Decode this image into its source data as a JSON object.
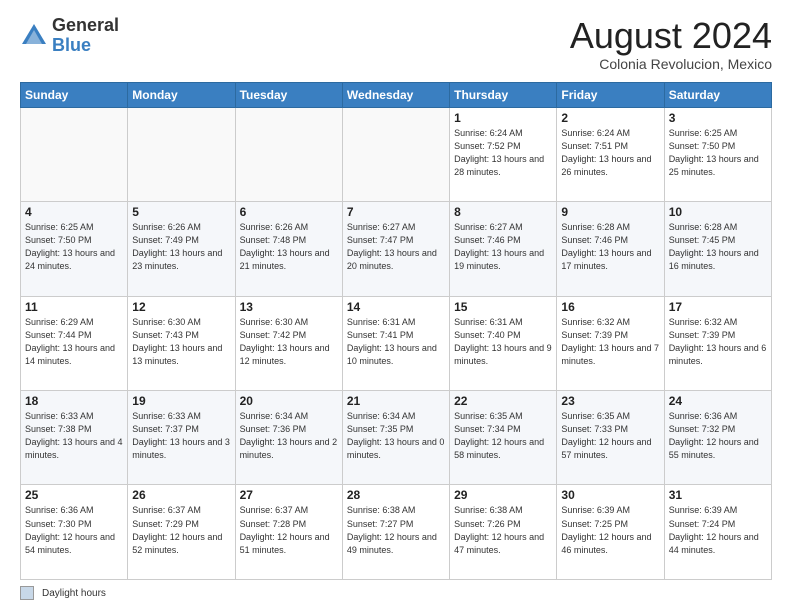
{
  "logo": {
    "general": "General",
    "blue": "Blue"
  },
  "title": "August 2024",
  "location": "Colonia Revolucion, Mexico",
  "days_header": [
    "Sunday",
    "Monday",
    "Tuesday",
    "Wednesday",
    "Thursday",
    "Friday",
    "Saturday"
  ],
  "footer_legend": "Daylight hours",
  "weeks": [
    [
      {
        "day": "",
        "info": ""
      },
      {
        "day": "",
        "info": ""
      },
      {
        "day": "",
        "info": ""
      },
      {
        "day": "",
        "info": ""
      },
      {
        "day": "1",
        "info": "Sunrise: 6:24 AM\nSunset: 7:52 PM\nDaylight: 13 hours\nand 28 minutes."
      },
      {
        "day": "2",
        "info": "Sunrise: 6:24 AM\nSunset: 7:51 PM\nDaylight: 13 hours\nand 26 minutes."
      },
      {
        "day": "3",
        "info": "Sunrise: 6:25 AM\nSunset: 7:50 PM\nDaylight: 13 hours\nand 25 minutes."
      }
    ],
    [
      {
        "day": "4",
        "info": "Sunrise: 6:25 AM\nSunset: 7:50 PM\nDaylight: 13 hours\nand 24 minutes."
      },
      {
        "day": "5",
        "info": "Sunrise: 6:26 AM\nSunset: 7:49 PM\nDaylight: 13 hours\nand 23 minutes."
      },
      {
        "day": "6",
        "info": "Sunrise: 6:26 AM\nSunset: 7:48 PM\nDaylight: 13 hours\nand 21 minutes."
      },
      {
        "day": "7",
        "info": "Sunrise: 6:27 AM\nSunset: 7:47 PM\nDaylight: 13 hours\nand 20 minutes."
      },
      {
        "day": "8",
        "info": "Sunrise: 6:27 AM\nSunset: 7:46 PM\nDaylight: 13 hours\nand 19 minutes."
      },
      {
        "day": "9",
        "info": "Sunrise: 6:28 AM\nSunset: 7:46 PM\nDaylight: 13 hours\nand 17 minutes."
      },
      {
        "day": "10",
        "info": "Sunrise: 6:28 AM\nSunset: 7:45 PM\nDaylight: 13 hours\nand 16 minutes."
      }
    ],
    [
      {
        "day": "11",
        "info": "Sunrise: 6:29 AM\nSunset: 7:44 PM\nDaylight: 13 hours\nand 14 minutes."
      },
      {
        "day": "12",
        "info": "Sunrise: 6:30 AM\nSunset: 7:43 PM\nDaylight: 13 hours\nand 13 minutes."
      },
      {
        "day": "13",
        "info": "Sunrise: 6:30 AM\nSunset: 7:42 PM\nDaylight: 13 hours\nand 12 minutes."
      },
      {
        "day": "14",
        "info": "Sunrise: 6:31 AM\nSunset: 7:41 PM\nDaylight: 13 hours\nand 10 minutes."
      },
      {
        "day": "15",
        "info": "Sunrise: 6:31 AM\nSunset: 7:40 PM\nDaylight: 13 hours\nand 9 minutes."
      },
      {
        "day": "16",
        "info": "Sunrise: 6:32 AM\nSunset: 7:39 PM\nDaylight: 13 hours\nand 7 minutes."
      },
      {
        "day": "17",
        "info": "Sunrise: 6:32 AM\nSunset: 7:39 PM\nDaylight: 13 hours\nand 6 minutes."
      }
    ],
    [
      {
        "day": "18",
        "info": "Sunrise: 6:33 AM\nSunset: 7:38 PM\nDaylight: 13 hours\nand 4 minutes."
      },
      {
        "day": "19",
        "info": "Sunrise: 6:33 AM\nSunset: 7:37 PM\nDaylight: 13 hours\nand 3 minutes."
      },
      {
        "day": "20",
        "info": "Sunrise: 6:34 AM\nSunset: 7:36 PM\nDaylight: 13 hours\nand 2 minutes."
      },
      {
        "day": "21",
        "info": "Sunrise: 6:34 AM\nSunset: 7:35 PM\nDaylight: 13 hours\nand 0 minutes."
      },
      {
        "day": "22",
        "info": "Sunrise: 6:35 AM\nSunset: 7:34 PM\nDaylight: 12 hours\nand 58 minutes."
      },
      {
        "day": "23",
        "info": "Sunrise: 6:35 AM\nSunset: 7:33 PM\nDaylight: 12 hours\nand 57 minutes."
      },
      {
        "day": "24",
        "info": "Sunrise: 6:36 AM\nSunset: 7:32 PM\nDaylight: 12 hours\nand 55 minutes."
      }
    ],
    [
      {
        "day": "25",
        "info": "Sunrise: 6:36 AM\nSunset: 7:30 PM\nDaylight: 12 hours\nand 54 minutes."
      },
      {
        "day": "26",
        "info": "Sunrise: 6:37 AM\nSunset: 7:29 PM\nDaylight: 12 hours\nand 52 minutes."
      },
      {
        "day": "27",
        "info": "Sunrise: 6:37 AM\nSunset: 7:28 PM\nDaylight: 12 hours\nand 51 minutes."
      },
      {
        "day": "28",
        "info": "Sunrise: 6:38 AM\nSunset: 7:27 PM\nDaylight: 12 hours\nand 49 minutes."
      },
      {
        "day": "29",
        "info": "Sunrise: 6:38 AM\nSunset: 7:26 PM\nDaylight: 12 hours\nand 47 minutes."
      },
      {
        "day": "30",
        "info": "Sunrise: 6:39 AM\nSunset: 7:25 PM\nDaylight: 12 hours\nand 46 minutes."
      },
      {
        "day": "31",
        "info": "Sunrise: 6:39 AM\nSunset: 7:24 PM\nDaylight: 12 hours\nand 44 minutes."
      }
    ]
  ]
}
